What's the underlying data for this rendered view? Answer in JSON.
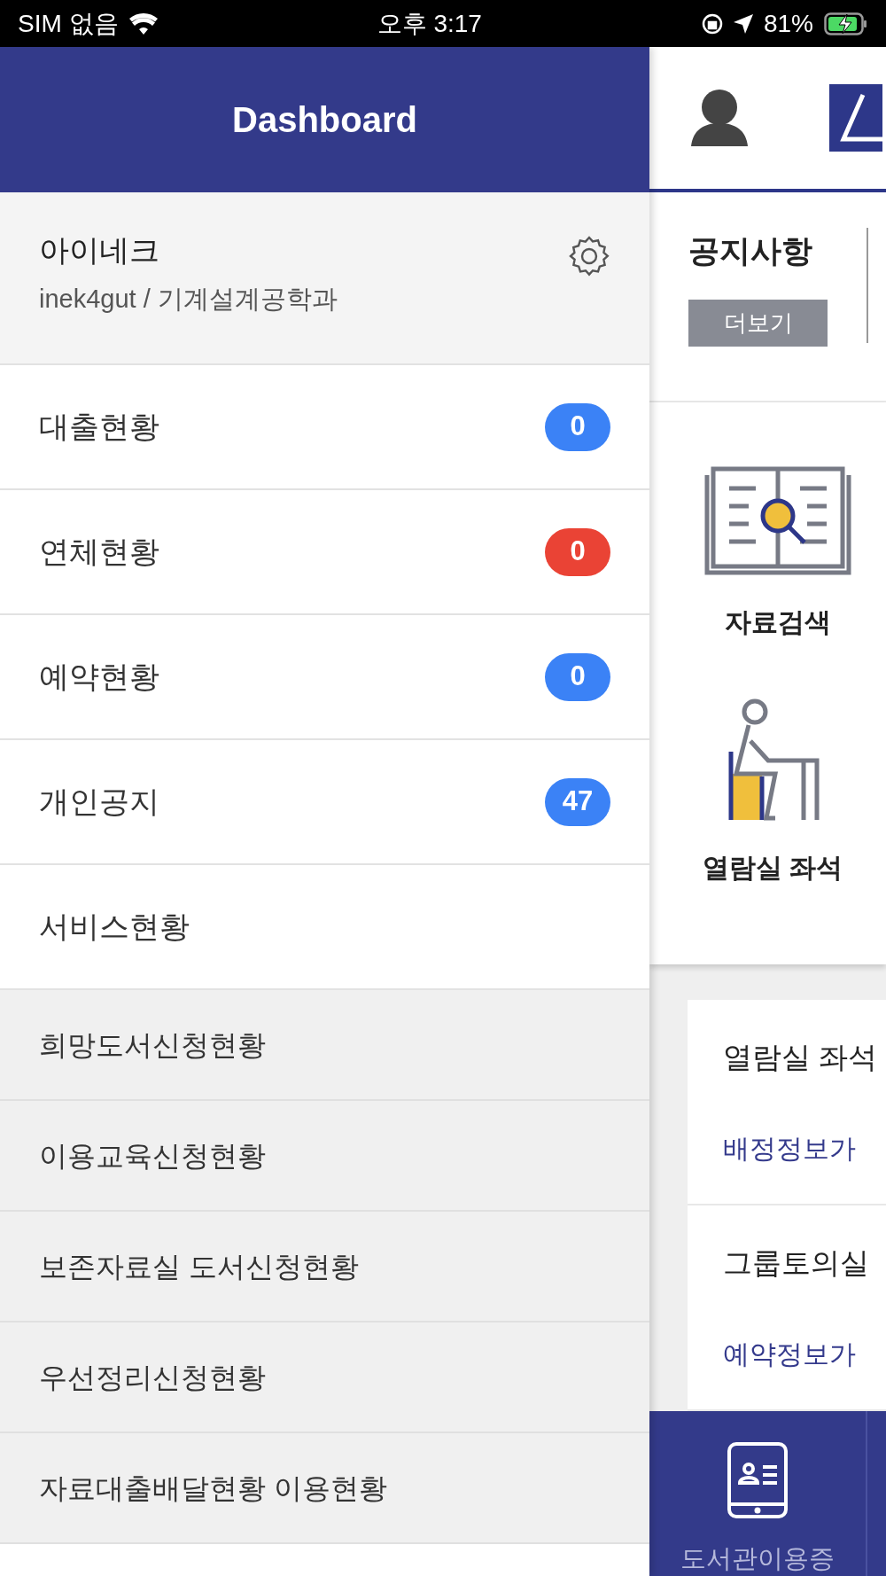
{
  "status_bar": {
    "carrier": "SIM 없음",
    "time": "오후 3:17",
    "battery": "81%"
  },
  "drawer": {
    "title": "Dashboard",
    "profile": {
      "name": "아이네크",
      "detail": "inek4gut / 기계설계공학과"
    },
    "items": [
      {
        "label": "대출현황",
        "badge": "0",
        "color": "#3b82f6"
      },
      {
        "label": "연체현황",
        "badge": "0",
        "color": "#ea4335"
      },
      {
        "label": "예약현황",
        "badge": "0",
        "color": "#3b82f6"
      },
      {
        "label": "개인공지",
        "badge": "47",
        "color": "#3b82f6"
      },
      {
        "label": "서비스현황"
      }
    ],
    "sub_items": [
      "희망도서신청현황",
      "이용교육신청현황",
      "보존자료실 도서신청현황",
      "우선정리신청현황",
      "자료대출배달현황 이용현황"
    ]
  },
  "main": {
    "notice": {
      "title": "공지사항",
      "more": "더보기"
    },
    "shortcuts": [
      {
        "label": "자료검색",
        "kind": "search"
      },
      {
        "label": "열람실 좌석",
        "kind": "seat"
      }
    ],
    "cards": [
      {
        "title": "열람실 좌석",
        "text": "배정정보가"
      },
      {
        "title": "그룹토의실",
        "text": "예약정보가"
      }
    ],
    "bottom_nav": [
      {
        "label": "도서관이용증"
      }
    ]
  }
}
